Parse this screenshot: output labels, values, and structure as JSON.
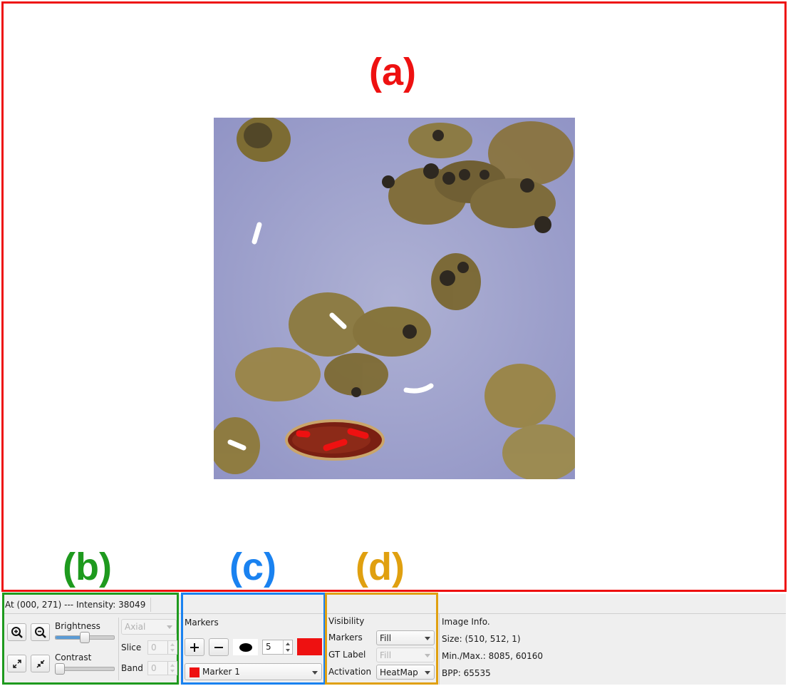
{
  "labels": {
    "a": "(a)",
    "b": "(b)",
    "c": "(c)",
    "d": "(d)"
  },
  "colors": {
    "a": "#ee1111",
    "b": "#1e9a1e",
    "c": "#1a82f0",
    "d": "#e0a010",
    "marker1": "#ee1111"
  },
  "viewer": {
    "image_alt": "microscopy image with markers"
  },
  "status": {
    "cursor_info": "At (000, 271) --- Intensity: 38049"
  },
  "view_controls": {
    "zoom_in_icon": "zoom-in-icon",
    "zoom_out_icon": "zoom-out-icon",
    "brightness_label": "Brightness",
    "brightness_value": 0.5,
    "contrast_label": "Contrast",
    "contrast_value": 0.0,
    "expand_icon": "expand-icon",
    "shrink_icon": "shrink-icon",
    "orientation": "Axial",
    "slice_label": "Slice",
    "slice_value": "0",
    "band_label": "Band",
    "band_value": "0"
  },
  "markers": {
    "title": "Markers",
    "add_icon": "plus-icon",
    "remove_icon": "minus-icon",
    "brush_icon": "ellipse-brush-icon",
    "brush_size": "5",
    "selected_marker": "Marker 1"
  },
  "visibility": {
    "title": "Visibility",
    "markers_label": "Markers",
    "markers_value": "Fill",
    "gt_label": "GT Label",
    "gt_value": "Fill",
    "activation_label": "Activation",
    "activation_value": "HeatMap"
  },
  "image_info": {
    "title": "Image Info.",
    "size": "Size: (510, 512, 1)",
    "minmax": "Min./Max.: 8085, 60160",
    "bpp": "BPP: 65535"
  }
}
